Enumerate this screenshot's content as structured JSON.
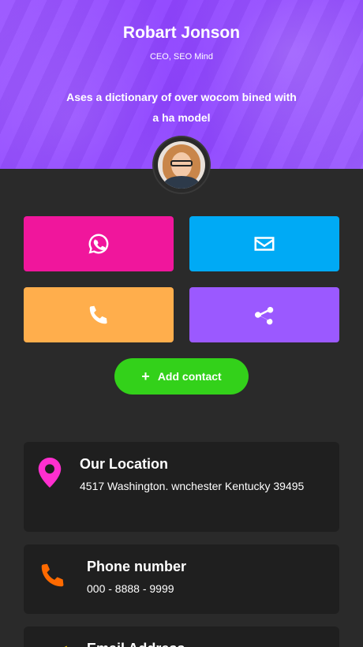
{
  "profile": {
    "name": "Robart Jonson",
    "role": "CEO, SEO Mind",
    "tagline": "Ases a dictionary of over wocom bined with a ha model"
  },
  "actions": [
    {
      "icon": "whatsapp-icon",
      "color": "#f0169c"
    },
    {
      "icon": "envelope-icon",
      "color": "#00aaf5"
    },
    {
      "icon": "phone-icon",
      "color": "#ffae4c"
    },
    {
      "icon": "share-icon",
      "color": "#9b59ff"
    }
  ],
  "add_contact": {
    "label": "Add contact",
    "color": "#33d11a"
  },
  "contact_cards": {
    "location": {
      "title": "Our Location",
      "value": "4517 Washington. wnchester Kentucky 39495",
      "icon_color": "#ff2fcf"
    },
    "phone": {
      "title": "Phone number",
      "value": "000 - 8888 - 9999",
      "icon_color": "#ff6a00"
    },
    "email": {
      "title": "Email Address",
      "icon_color": "#ffd000"
    }
  },
  "colors": {
    "background": "#2a2a2a",
    "card": "#1f1f1f",
    "hero": "#9a55ff"
  }
}
